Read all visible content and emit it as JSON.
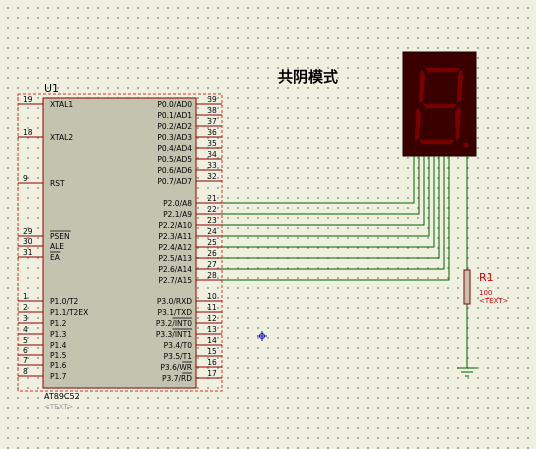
{
  "title": "共阴模式",
  "mcu": {
    "ref": "U1",
    "part": "AT89C52",
    "text": "<TEXT>",
    "left_pins": [
      {
        "num": "19",
        "name": "XTAL1"
      },
      {
        "num": "18",
        "name": "XTAL2"
      },
      {
        "num": "9",
        "name": "RST"
      },
      {
        "num": "29",
        "name": "PSEN"
      },
      {
        "num": "30",
        "name": "ALE"
      },
      {
        "num": "31",
        "name": "EA"
      },
      {
        "num": "1",
        "name": "P1.0/T2"
      },
      {
        "num": "2",
        "name": "P1.1/T2EX"
      },
      {
        "num": "3",
        "name": "P1.2"
      },
      {
        "num": "4",
        "name": "P1.3"
      },
      {
        "num": "5",
        "name": "P1.4"
      },
      {
        "num": "6",
        "name": "P1.5"
      },
      {
        "num": "7",
        "name": "P1.6"
      },
      {
        "num": "8",
        "name": "P1.7"
      }
    ],
    "right_pins": [
      {
        "num": "39",
        "name": "P0.0/AD0"
      },
      {
        "num": "38",
        "name": "P0.1/AD1"
      },
      {
        "num": "37",
        "name": "P0.2/AD2"
      },
      {
        "num": "36",
        "name": "P0.3/AD3"
      },
      {
        "num": "35",
        "name": "P0.4/AD4"
      },
      {
        "num": "34",
        "name": "P0.5/AD5"
      },
      {
        "num": "33",
        "name": "P0.6/AD6"
      },
      {
        "num": "32",
        "name": "P0.7/AD7"
      },
      {
        "num": "21",
        "name": "P2.0/A8"
      },
      {
        "num": "22",
        "name": "P2.1/A9"
      },
      {
        "num": "23",
        "name": "P2.2/A10"
      },
      {
        "num": "24",
        "name": "P2.3/A11"
      },
      {
        "num": "25",
        "name": "P2.4/A12"
      },
      {
        "num": "26",
        "name": "P2.5/A13"
      },
      {
        "num": "27",
        "name": "P2.6/A14"
      },
      {
        "num": "28",
        "name": "P2.7/A15"
      },
      {
        "num": "10",
        "name": "P3.0/RXD"
      },
      {
        "num": "11",
        "name": "P3.1/TXD"
      },
      {
        "num": "12",
        "name": "P3.2/INT0"
      },
      {
        "num": "13",
        "name": "P3.3/INT1"
      },
      {
        "num": "14",
        "name": "P3.4/T0"
      },
      {
        "num": "15",
        "name": "P3.5/T1"
      },
      {
        "num": "16",
        "name": "P3.6/WR"
      },
      {
        "num": "17",
        "name": "P3.7/RD"
      }
    ]
  },
  "resistor": {
    "ref": "R1",
    "value": "100",
    "text": "<TEXT>"
  },
  "colors": {
    "background": "#f0f0e1",
    "chip_fill": "#c3c3b0",
    "chip_border": "#8b0000",
    "selection": "#e03030",
    "wire": "#006400",
    "display_body": "#3a0000",
    "display_segment": "#7a0000",
    "marker": "#1010c0"
  }
}
